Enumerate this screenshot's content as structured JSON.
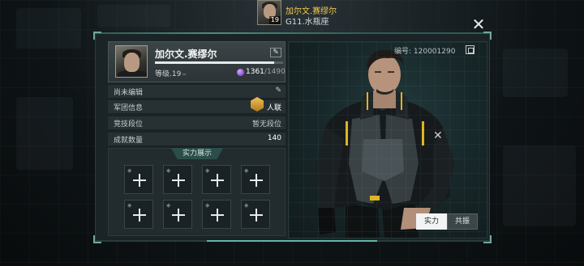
{
  "header": {
    "player_name": "加尔文.赛缪尔",
    "zodiac": "G11.水瓶座",
    "avatar_level": "19",
    "close_icon": "close-icon"
  },
  "profile": {
    "name": "加尔文.赛缪尔",
    "edit_icon": "edit-icon",
    "level_label": "等级.",
    "level_value": "19",
    "level_max_marker": "∞",
    "exp_progress_fraction": 0.93,
    "power_current": "1361",
    "power_separator": "/",
    "power_max": "1490",
    "player_id": "编号: 120001290"
  },
  "info_rows": [
    {
      "label": "尚未编辑",
      "value": ""
    },
    {
      "label": "军团信息",
      "value": "人联"
    },
    {
      "label": "竞技段位",
      "value": "暂无段位"
    },
    {
      "label": "成就数量",
      "value": "140"
    }
  ],
  "showcase": {
    "title": "实力展示",
    "slot_icon": "plus-icon",
    "slot_count": 8
  },
  "tabs": [
    {
      "label": "实力",
      "active": true
    },
    {
      "label": "共振",
      "active": false
    }
  ],
  "colors": {
    "accent_teal": "#5fb6aa",
    "name_gold": "#f0c94a",
    "power_purple": "#8a4fd8"
  }
}
